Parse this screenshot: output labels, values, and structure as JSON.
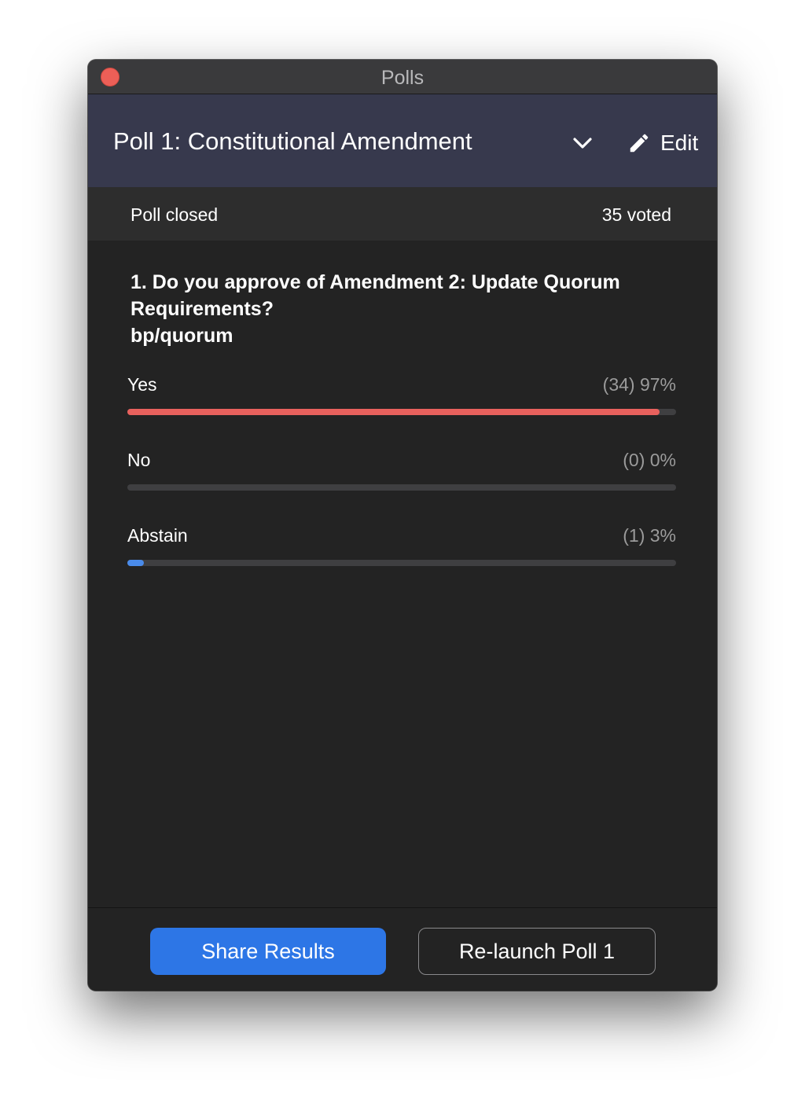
{
  "window": {
    "title": "Polls"
  },
  "header": {
    "poll_title": "Poll 1: Constitutional Amendment",
    "edit_label": "Edit"
  },
  "status": {
    "state": "Poll closed",
    "voted": "35 voted"
  },
  "question": {
    "text": "1. Do you approve of Amendment 2: Update Quorum Requirements?\nbp/quorum"
  },
  "answers": [
    {
      "label": "Yes",
      "stat": "(34) 97%",
      "fraction": 0.97,
      "color": "#e8615d"
    },
    {
      "label": "No",
      "stat": "(0) 0%",
      "fraction": 0.0,
      "color": "#e8615d"
    },
    {
      "label": "Abstain",
      "stat": "(1) 3%",
      "fraction": 0.03,
      "color": "#4a8bea"
    }
  ],
  "footer": {
    "share_label": "Share Results",
    "relaunch_label": "Re-launch Poll 1"
  },
  "colors": {
    "accent_blue": "#2d76e6",
    "header_bg": "#37394d",
    "close_red": "#ec5f57"
  },
  "icons": {
    "close": "close-icon",
    "dropdown": "chevron-down-icon",
    "edit": "pencil-icon"
  }
}
